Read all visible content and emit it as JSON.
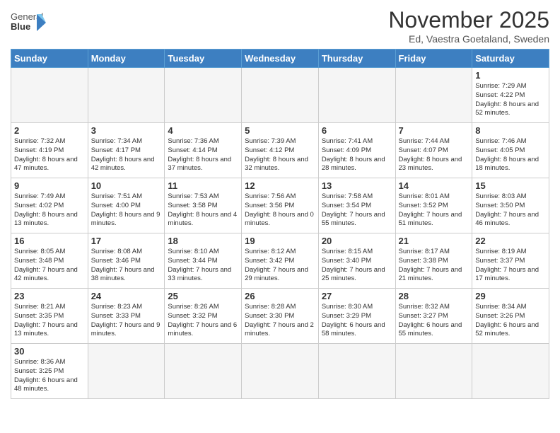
{
  "logo": {
    "text_normal": "General",
    "text_bold": "Blue"
  },
  "title": "November 2025",
  "subtitle": "Ed, Vaestra Goetaland, Sweden",
  "weekdays": [
    "Sunday",
    "Monday",
    "Tuesday",
    "Wednesday",
    "Thursday",
    "Friday",
    "Saturday"
  ],
  "days": {
    "1": {
      "sunrise": "7:29 AM",
      "sunset": "4:22 PM",
      "daylight": "8 hours and 52 minutes."
    },
    "2": {
      "sunrise": "7:32 AM",
      "sunset": "4:19 PM",
      "daylight": "8 hours and 47 minutes."
    },
    "3": {
      "sunrise": "7:34 AM",
      "sunset": "4:17 PM",
      "daylight": "8 hours and 42 minutes."
    },
    "4": {
      "sunrise": "7:36 AM",
      "sunset": "4:14 PM",
      "daylight": "8 hours and 37 minutes."
    },
    "5": {
      "sunrise": "7:39 AM",
      "sunset": "4:12 PM",
      "daylight": "8 hours and 32 minutes."
    },
    "6": {
      "sunrise": "7:41 AM",
      "sunset": "4:09 PM",
      "daylight": "8 hours and 28 minutes."
    },
    "7": {
      "sunrise": "7:44 AM",
      "sunset": "4:07 PM",
      "daylight": "8 hours and 23 minutes."
    },
    "8": {
      "sunrise": "7:46 AM",
      "sunset": "4:05 PM",
      "daylight": "8 hours and 18 minutes."
    },
    "9": {
      "sunrise": "7:49 AM",
      "sunset": "4:02 PM",
      "daylight": "8 hours and 13 minutes."
    },
    "10": {
      "sunrise": "7:51 AM",
      "sunset": "4:00 PM",
      "daylight": "8 hours and 9 minutes."
    },
    "11": {
      "sunrise": "7:53 AM",
      "sunset": "3:58 PM",
      "daylight": "8 hours and 4 minutes."
    },
    "12": {
      "sunrise": "7:56 AM",
      "sunset": "3:56 PM",
      "daylight": "8 hours and 0 minutes."
    },
    "13": {
      "sunrise": "7:58 AM",
      "sunset": "3:54 PM",
      "daylight": "7 hours and 55 minutes."
    },
    "14": {
      "sunrise": "8:01 AM",
      "sunset": "3:52 PM",
      "daylight": "7 hours and 51 minutes."
    },
    "15": {
      "sunrise": "8:03 AM",
      "sunset": "3:50 PM",
      "daylight": "7 hours and 46 minutes."
    },
    "16": {
      "sunrise": "8:05 AM",
      "sunset": "3:48 PM",
      "daylight": "7 hours and 42 minutes."
    },
    "17": {
      "sunrise": "8:08 AM",
      "sunset": "3:46 PM",
      "daylight": "7 hours and 38 minutes."
    },
    "18": {
      "sunrise": "8:10 AM",
      "sunset": "3:44 PM",
      "daylight": "7 hours and 33 minutes."
    },
    "19": {
      "sunrise": "8:12 AM",
      "sunset": "3:42 PM",
      "daylight": "7 hours and 29 minutes."
    },
    "20": {
      "sunrise": "8:15 AM",
      "sunset": "3:40 PM",
      "daylight": "7 hours and 25 minutes."
    },
    "21": {
      "sunrise": "8:17 AM",
      "sunset": "3:38 PM",
      "daylight": "7 hours and 21 minutes."
    },
    "22": {
      "sunrise": "8:19 AM",
      "sunset": "3:37 PM",
      "daylight": "7 hours and 17 minutes."
    },
    "23": {
      "sunrise": "8:21 AM",
      "sunset": "3:35 PM",
      "daylight": "7 hours and 13 minutes."
    },
    "24": {
      "sunrise": "8:23 AM",
      "sunset": "3:33 PM",
      "daylight": "7 hours and 9 minutes."
    },
    "25": {
      "sunrise": "8:26 AM",
      "sunset": "3:32 PM",
      "daylight": "7 hours and 6 minutes."
    },
    "26": {
      "sunrise": "8:28 AM",
      "sunset": "3:30 PM",
      "daylight": "7 hours and 2 minutes."
    },
    "27": {
      "sunrise": "8:30 AM",
      "sunset": "3:29 PM",
      "daylight": "6 hours and 58 minutes."
    },
    "28": {
      "sunrise": "8:32 AM",
      "sunset": "3:27 PM",
      "daylight": "6 hours and 55 minutes."
    },
    "29": {
      "sunrise": "8:34 AM",
      "sunset": "3:26 PM",
      "daylight": "6 hours and 52 minutes."
    },
    "30": {
      "sunrise": "8:36 AM",
      "sunset": "3:25 PM",
      "daylight": "6 hours and 48 minutes."
    }
  }
}
